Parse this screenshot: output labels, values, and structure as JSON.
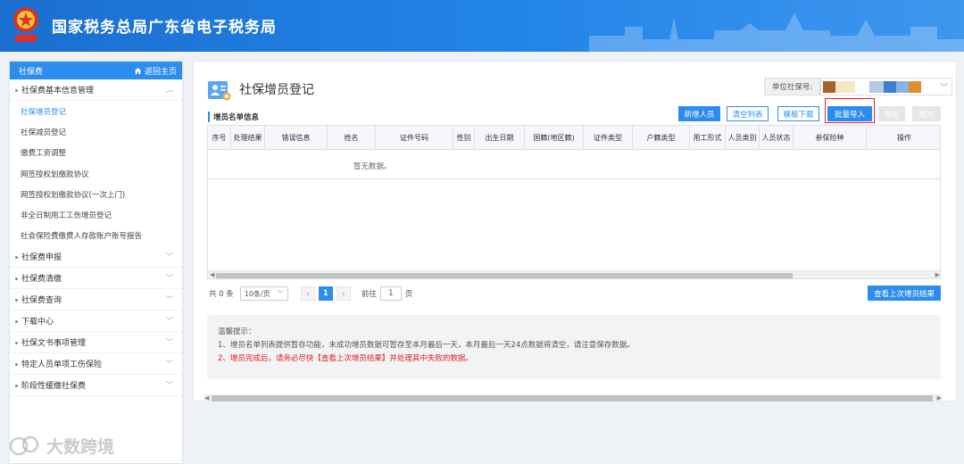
{
  "header": {
    "site_title": "国家税务总局广东省电子税务局",
    "emblem_caption": "中国税务"
  },
  "sidebar": {
    "title": "社保费",
    "home_label": "返回主页",
    "groups": [
      {
        "label": "社保费基本信息管理",
        "expanded": true,
        "items": [
          {
            "label": "社保增员登记",
            "active": true
          },
          {
            "label": "社保减员登记"
          },
          {
            "label": "缴费工资调整"
          },
          {
            "label": "网签授权划缴款协议"
          },
          {
            "label": "网签授权划缴款协议(一次上门)"
          },
          {
            "label": "非全日制用工工伤增员登记"
          },
          {
            "label": "社会保险费缴费人存款账户账号报告"
          }
        ]
      },
      {
        "label": "社保费申报"
      },
      {
        "label": "社保费清缴"
      },
      {
        "label": "社保费查询"
      },
      {
        "label": "下载中心"
      },
      {
        "label": "社保文书事项管理"
      },
      {
        "label": "特定人员单项工伤保险"
      },
      {
        "label": "阶段性缓缴社保费"
      }
    ]
  },
  "main": {
    "page_title": "社保增员登记",
    "unit_no_label": "单位社保号:",
    "unit_no_colors": [
      "#a8622a",
      "#f5e7c4",
      "#fdfdfd",
      "#b9c8e0",
      "#3e7fd0",
      "#86b3e8",
      "#e0902a"
    ],
    "section_title": "增员名单信息",
    "toolbar": {
      "add": "新增人员",
      "clear": "清空列表",
      "template": "模板下载",
      "import": "批量导入",
      "export": "导出",
      "submit": "提交"
    },
    "table": {
      "columns": [
        "序号",
        "处理结果",
        "错误信息",
        "姓名",
        "证件号码",
        "性别",
        "出生日期",
        "国籍(地区籍)",
        "证件类型",
        "户籍类型",
        "用工形式",
        "人员类别",
        "人员状态",
        "参保险种",
        "操作"
      ],
      "empty_text": "暂无数据。"
    },
    "pager": {
      "total": "共 0 条",
      "page_size": "10条/页",
      "current_page": "1",
      "goto_label": "前往",
      "goto_value": "1",
      "page_suffix": "页"
    },
    "view_last_button": "查看上次增员结果",
    "tips": {
      "title": "温馨提示：",
      "line1": "1、增员名单列表提供暂存功能，未成功增员数据可暂存至本月最后一天，本月最后一天24点数据将清空，请注意保存数据。",
      "line2": "2、增员完成后，请务必尽快【查看上次增员结果】并处理其中失败的数据。"
    }
  },
  "watermark": {
    "brand": "大数跨境"
  },
  "colors": {
    "primary": "#2d8cf0",
    "header": "#1f7ddb",
    "warning": "#e02020",
    "highlight_border": "#ee2222"
  }
}
